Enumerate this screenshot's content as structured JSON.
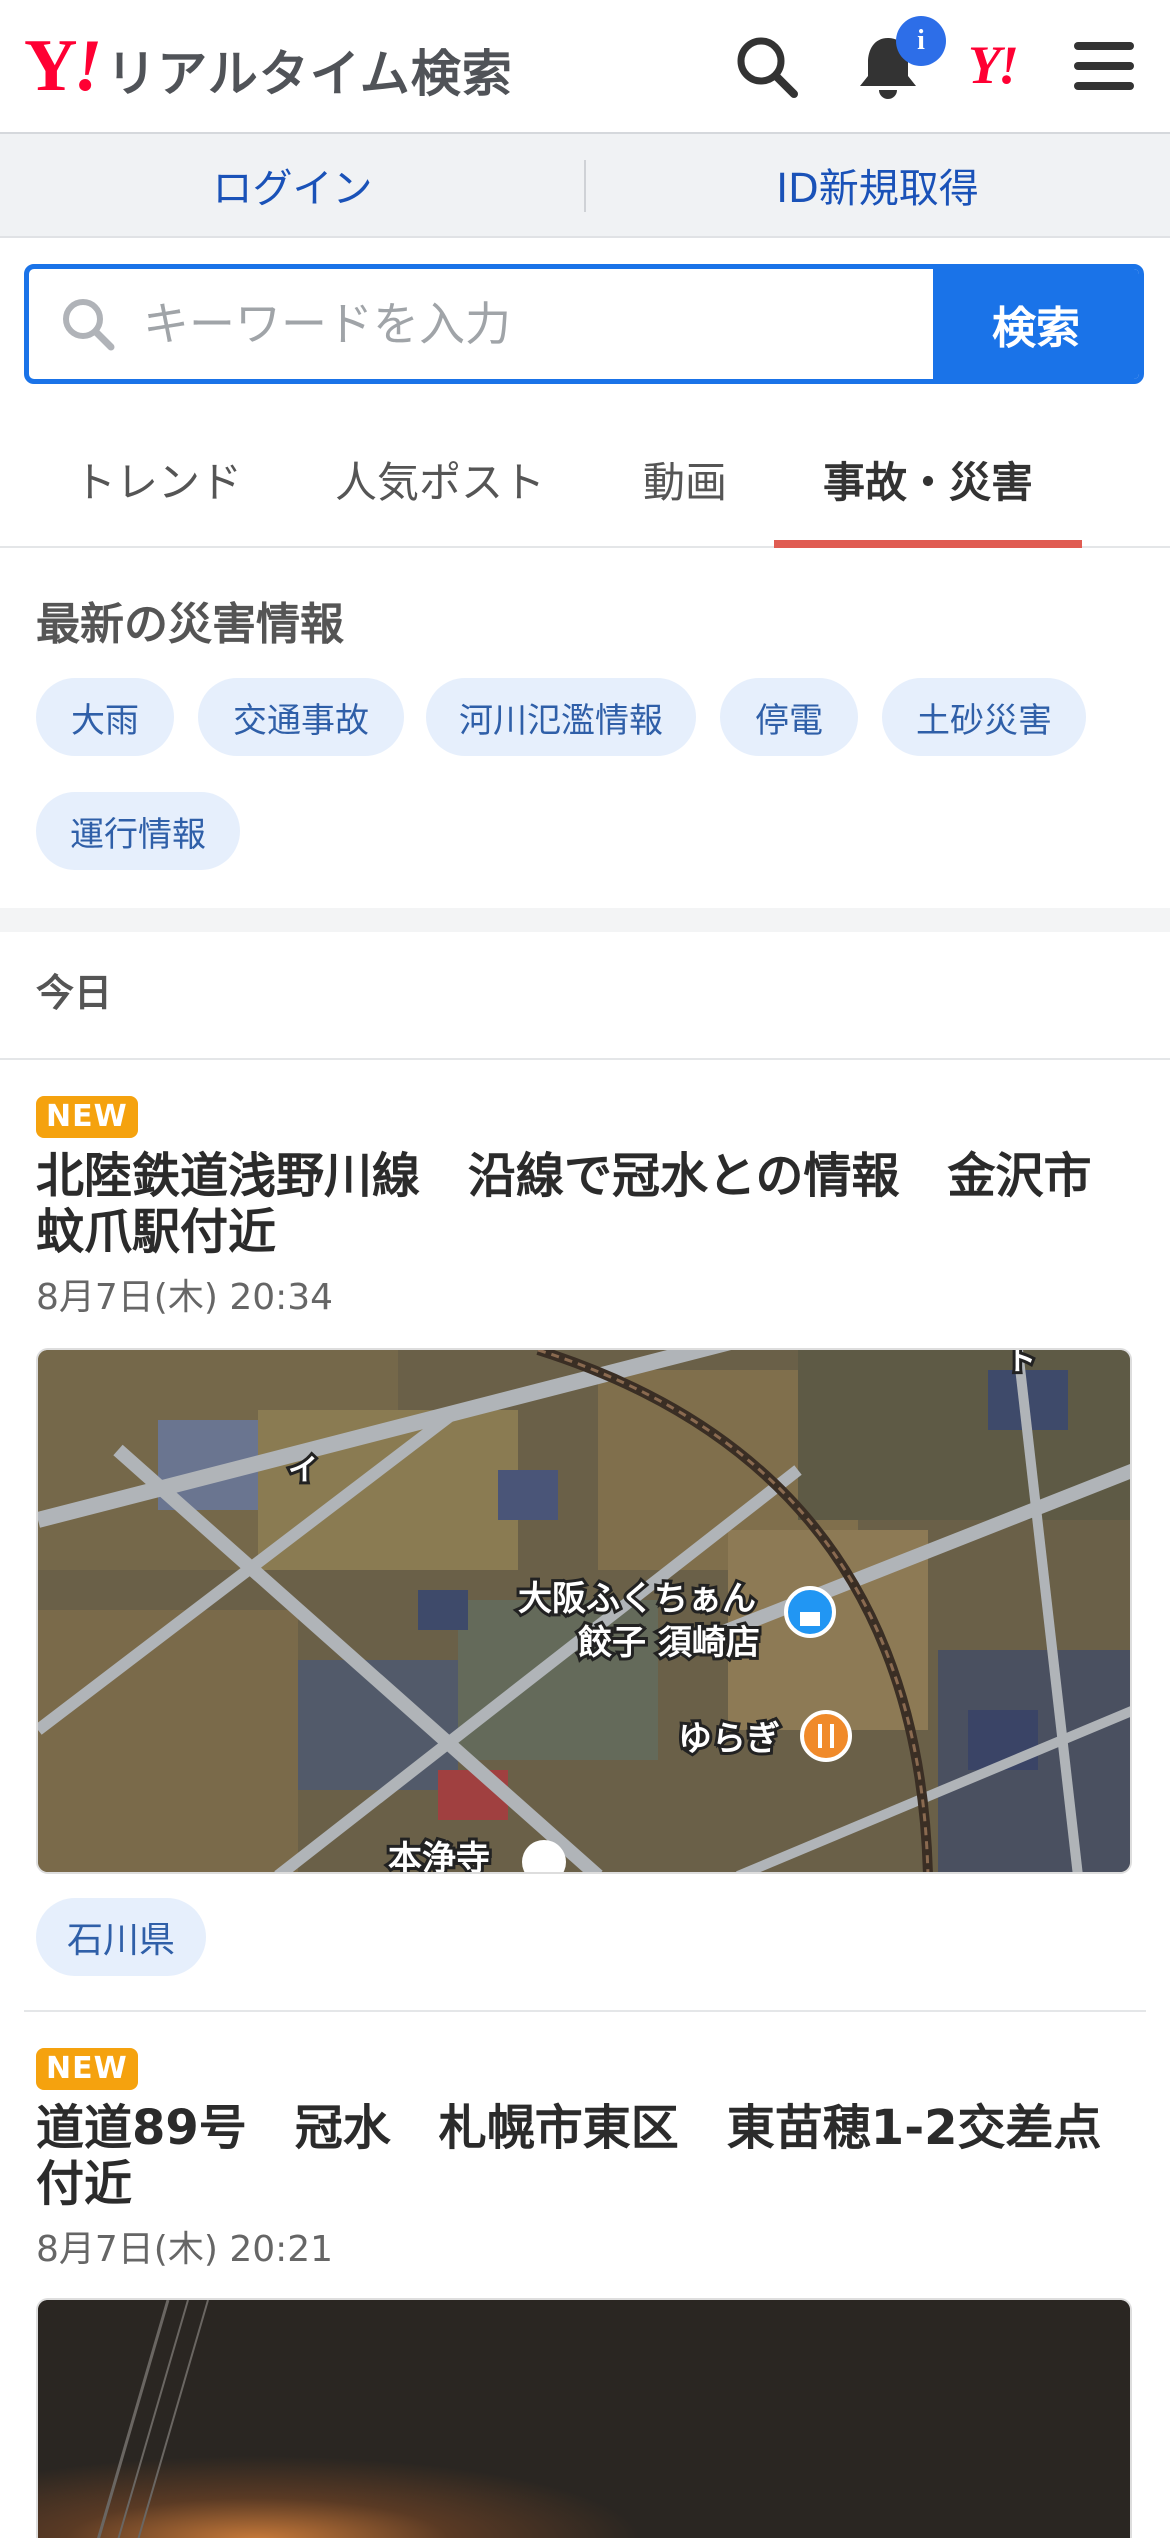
{
  "header": {
    "logo_text": "リアルタイム検索",
    "notification_badge": "i",
    "icons": [
      "search-icon",
      "bell-icon",
      "yahoo-logo-icon",
      "hamburger-menu-icon"
    ]
  },
  "account": {
    "login_label": "ログイン",
    "register_label": "ID新規取得"
  },
  "search": {
    "placeholder": "キーワードを入力",
    "value": "",
    "button_label": "検索"
  },
  "tabs": [
    {
      "label": "トレンド",
      "active": false
    },
    {
      "label": "人気ポスト",
      "active": false
    },
    {
      "label": "動画",
      "active": false
    },
    {
      "label": "事故・災害",
      "active": true
    }
  ],
  "disaster_info": {
    "title": "最新の災害情報",
    "chips": [
      "大雨",
      "交通事故",
      "河川氾濫情報",
      "停電",
      "土砂災害",
      "運行情報"
    ]
  },
  "feed": {
    "section_label": "今日",
    "articles": [
      {
        "badge": "NEW",
        "title": "北陸鉄道浅野川線　沿線で冠水との情報　金沢市蚊爪駅付近",
        "date": "8月7日(木) 20:34",
        "image": {
          "type": "map",
          "labels": [
            "大阪ふくちぁん",
            "餃子 須崎店",
            "ゆらぎ",
            "本浄寺",
            "イ",
            "ト"
          ]
        },
        "prefecture": "石川県"
      },
      {
        "badge": "NEW",
        "title": "道道89号　冠水　札幌市東区　東苗穂1-2交差点付近",
        "date": "8月7日(木) 20:21",
        "image": {
          "type": "night-photo"
        }
      }
    ]
  },
  "colors": {
    "accent_blue": "#1a73e8",
    "yahoo_red": "#ff0033",
    "active_tab_underline": "#e05c52",
    "new_badge": "#f5a20e",
    "chip_bg": "#e6effc",
    "chip_text": "#2f5fa8"
  }
}
